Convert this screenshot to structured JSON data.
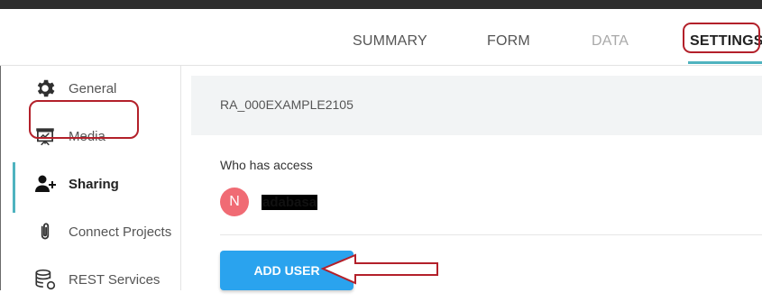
{
  "header": {
    "tabs": [
      {
        "label": "SUMMARY",
        "state": "normal"
      },
      {
        "label": "FORM",
        "state": "normal"
      },
      {
        "label": "DATA",
        "state": "disabled"
      },
      {
        "label": "SETTINGS",
        "state": "active"
      }
    ],
    "active_color": "#4fb3bf"
  },
  "sidebar": {
    "items": [
      {
        "label": "General",
        "icon": "gear-icon"
      },
      {
        "label": "Media",
        "icon": "presentation-icon"
      },
      {
        "label": "Sharing",
        "icon": "add-user-icon",
        "active": true
      },
      {
        "label": "Connect Projects",
        "icon": "paperclip-icon"
      },
      {
        "label": "REST Services",
        "icon": "database-icon"
      }
    ]
  },
  "main": {
    "project_id": "RA_000EXAMPLE2105",
    "access_title": "Who has access",
    "users": [
      {
        "initial": "N",
        "name": "adabasa",
        "avatar_color": "#f06b74"
      }
    ],
    "add_user_label": "ADD USER"
  },
  "annotations": {
    "color": "#b3202a"
  }
}
